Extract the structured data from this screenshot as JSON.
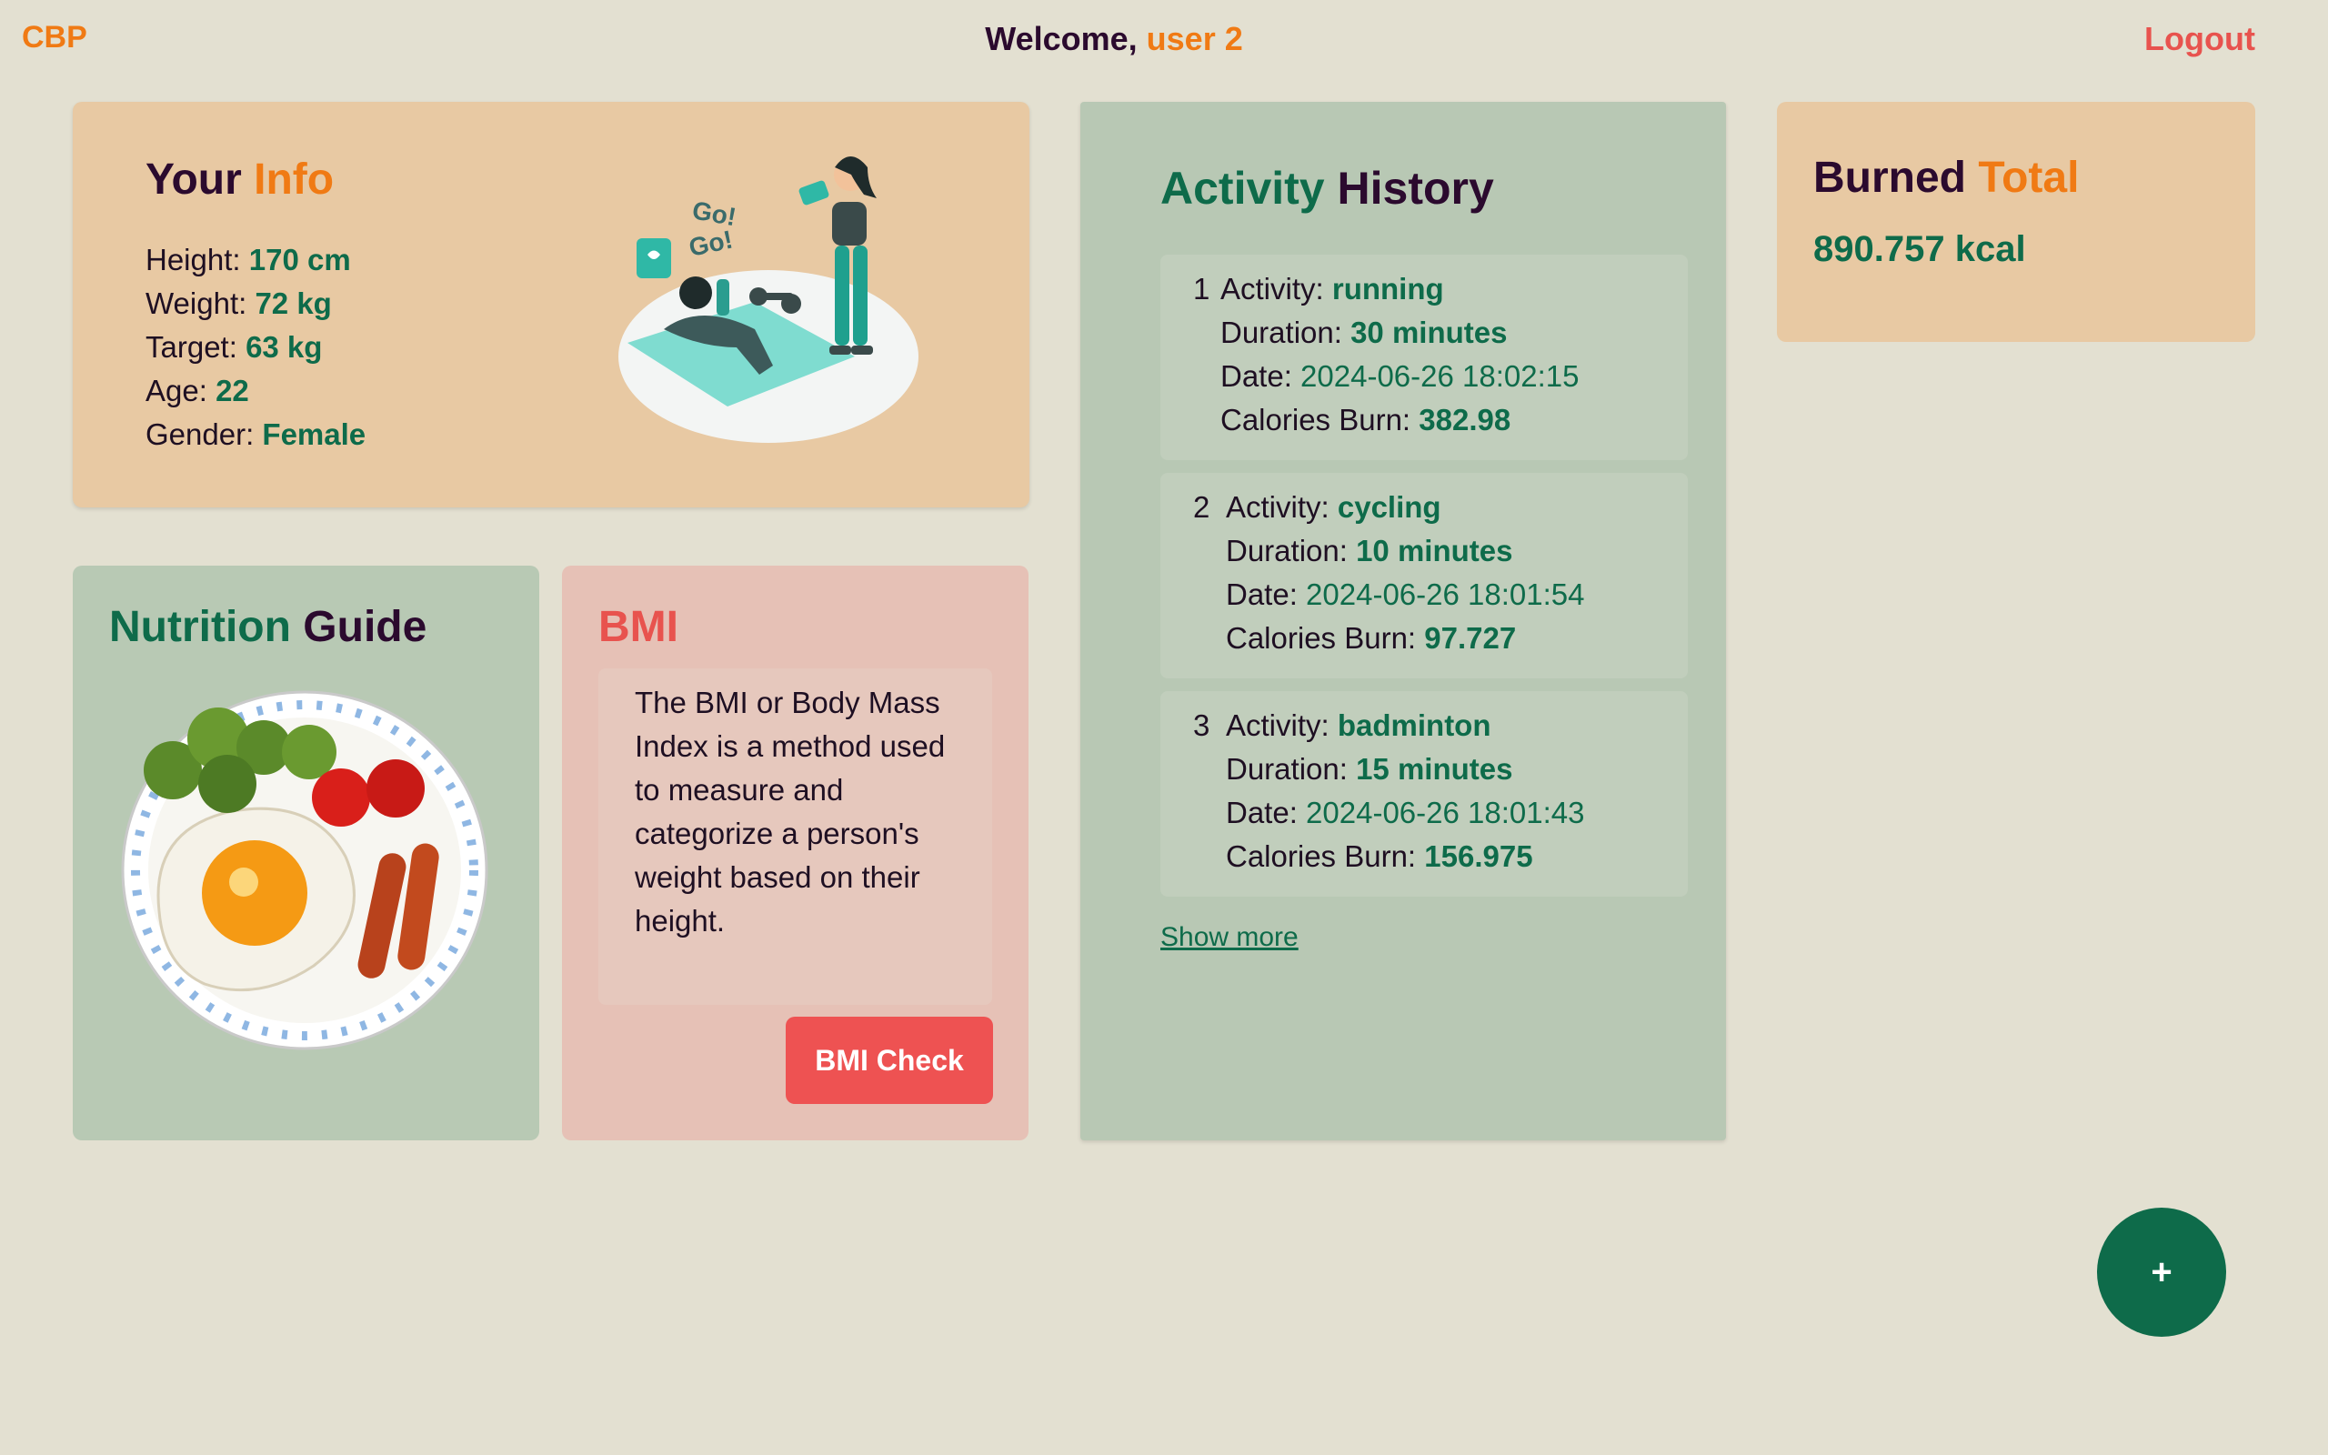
{
  "header": {
    "brand": "CBP",
    "welcome_prefix": "Welcome, ",
    "username": "user 2",
    "logout": "Logout"
  },
  "info": {
    "title_main": "Your",
    "title_accent": "Info",
    "fields": [
      {
        "label": "Height:",
        "value": "170 cm"
      },
      {
        "label": "Weight:",
        "value": "72 kg"
      },
      {
        "label": "Target:",
        "value": "63 kg"
      },
      {
        "label": "Age:",
        "value": "22"
      },
      {
        "label": "Gender:",
        "value": "Female"
      }
    ],
    "illustration_text": "Go!"
  },
  "nutrition": {
    "title_main": "Nutrition",
    "title_dark": "Guide"
  },
  "bmi": {
    "title": "BMI",
    "description": "The BMI or Body Mass Index is a method used to measure and categorize a person's weight based on their height.",
    "button": "BMI Check"
  },
  "history": {
    "title_main": "Activity",
    "title_dark": "History",
    "labels": {
      "activity": "Activity:",
      "duration": "Duration:",
      "date": "Date:",
      "calories": "Calories Burn:"
    },
    "items": [
      {
        "num": "1",
        "activity": "running",
        "duration": "30 minutes",
        "date": "2024-06-26 18:02:15",
        "calories": "382.98"
      },
      {
        "num": "2",
        "activity": "cycling",
        "duration": "10 minutes",
        "date": "2024-06-26 18:01:54",
        "calories": "97.727"
      },
      {
        "num": "3",
        "activity": "badminton",
        "duration": "15 minutes",
        "date": "2024-06-26 18:01:43",
        "calories": "156.975"
      }
    ],
    "show_more": "Show more"
  },
  "burned": {
    "title_main": "Burned",
    "title_accent": "Total",
    "value": "890.757 kcal"
  },
  "fab": {
    "label": "+"
  },
  "colors": {
    "background": "#e3e0d1",
    "accent_orange": "#f07a14",
    "accent_green": "#0e6b4a",
    "accent_red": "#e8534e",
    "dark": "#2b0a2e"
  }
}
